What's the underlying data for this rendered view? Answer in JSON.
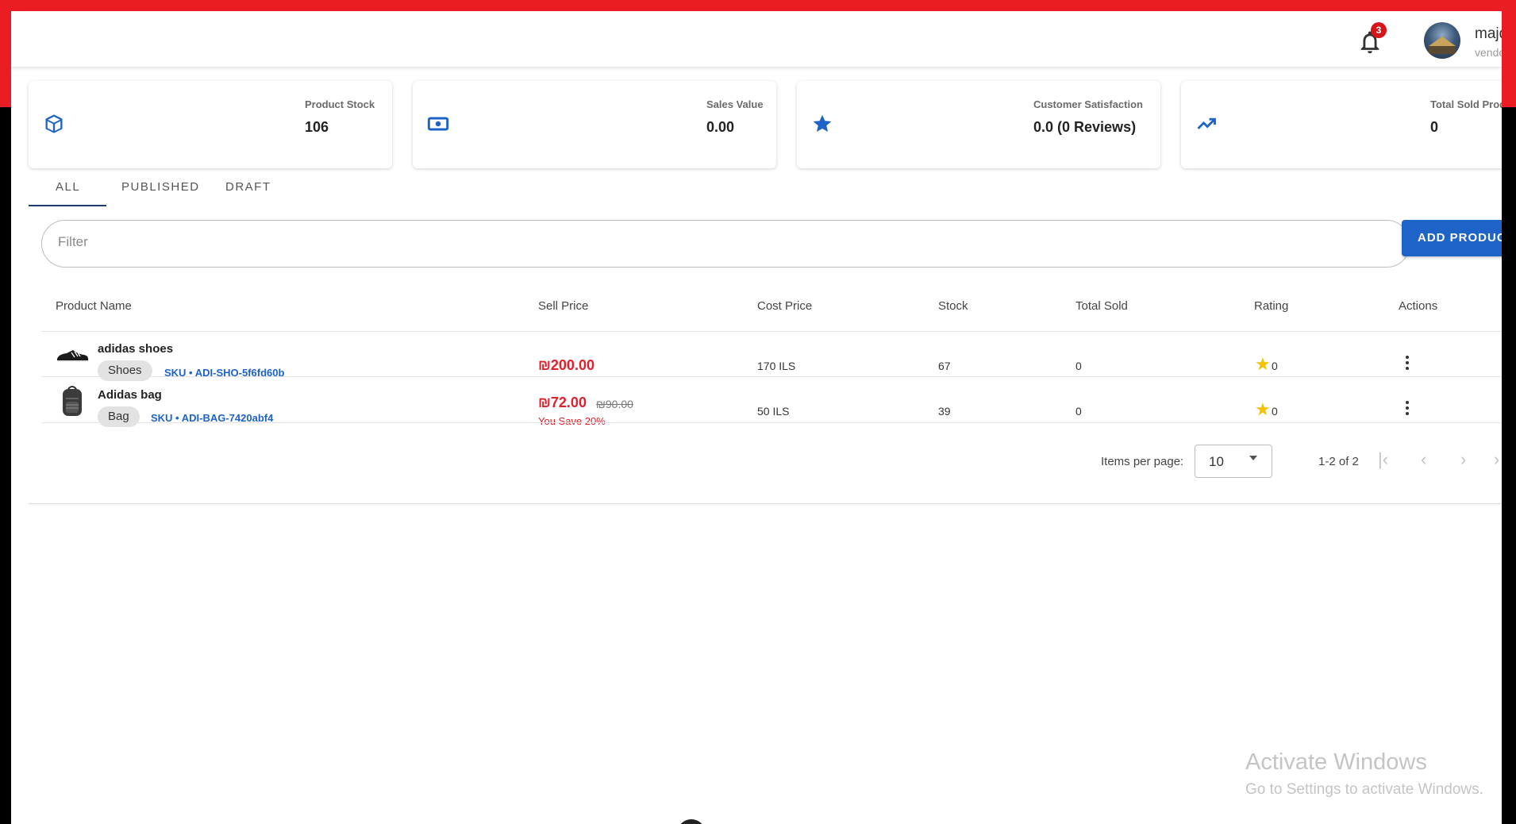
{
  "header": {
    "notification_count": "3",
    "user_name": "majd",
    "user_role": "vendor"
  },
  "stats": [
    {
      "label": "Product Stock",
      "value": "106",
      "icon": "cube-icon"
    },
    {
      "label": "Sales Value",
      "value": "0.00",
      "icon": "cash-icon"
    },
    {
      "label": "Customer Satisfaction",
      "value": "0.0 (0 Reviews)",
      "icon": "star-icon"
    },
    {
      "label": "Total Sold Products",
      "value": "0",
      "icon": "trending-up-icon"
    }
  ],
  "tabs": [
    {
      "label": "ALL",
      "active": true
    },
    {
      "label": "PUBLISHED",
      "active": false
    },
    {
      "label": "DRAFT",
      "active": false
    }
  ],
  "filter": {
    "placeholder": "Filter"
  },
  "add_button": {
    "label": "ADD PRODUCT"
  },
  "table": {
    "columns": [
      "Product Name",
      "Sell Price",
      "Cost Price",
      "Stock",
      "Total Sold",
      "Rating",
      "Actions"
    ],
    "rows": [
      {
        "name": "adidas shoes",
        "category": "Shoes",
        "sku": "SKU • ADI-SHO-5f6fd60b",
        "sell_price": "₪200.00",
        "cost_price": "170 ILS",
        "stock": "67",
        "total_sold": "0",
        "rating": "0"
      },
      {
        "name": "Adidas bag",
        "category": "Bag",
        "sku": "SKU • ADI-BAG-7420abf4",
        "sell_price": "₪72.00",
        "old_price": "₪90.00",
        "save_text": "You Save 20%",
        "cost_price": "50 ILS",
        "stock": "39",
        "total_sold": "0",
        "rating": "0"
      }
    ]
  },
  "pagination": {
    "items_per_page_label": "Items per page:",
    "items_per_page": "10",
    "range": "1-2 of 2"
  },
  "windows_watermark": {
    "title": "Activate Windows",
    "subtitle": "Go to Settings to activate Windows."
  },
  "colors": {
    "accent": "#1e63c8",
    "price_red": "#e0202a",
    "frame_red": "#ea1c24",
    "star": "#f2c200"
  }
}
